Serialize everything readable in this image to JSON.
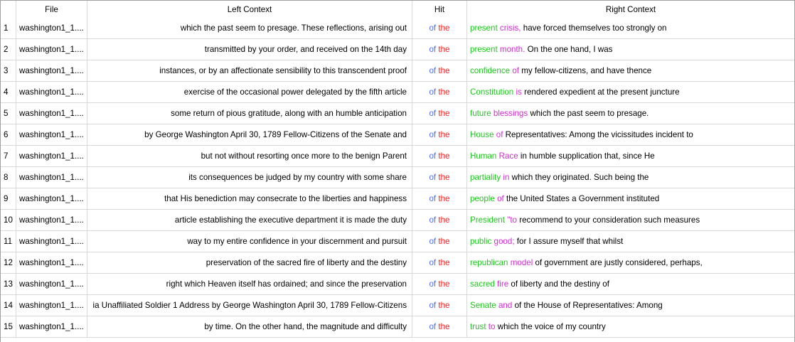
{
  "columns": {
    "num": "",
    "file": "File",
    "left": "Left Context",
    "hit": "Hit",
    "right": "Right Context"
  },
  "colors": {
    "hit_word1": "#4a6cf7",
    "hit_word2": "#ff1a1a",
    "right_word1": "#1ec81e",
    "right_word2": "#d22bd2"
  },
  "rows": [
    {
      "n": "1",
      "file": "washington1_1....",
      "left": "which the past seem to presage. These reflections, arising out",
      "hit1": "of",
      "hit2": "the",
      "r1": "present",
      "r2": "crisis,",
      "rest": "have forced themselves too strongly on"
    },
    {
      "n": "2",
      "file": "washington1_1....",
      "left": "transmitted by your order, and received on the 14th day",
      "hit1": "of",
      "hit2": "the",
      "r1": "present",
      "r2": "month.",
      "rest": "On the one hand, I was"
    },
    {
      "n": "3",
      "file": "washington1_1....",
      "left": "instances, or by an affectionate sensibility to this transcendent proof",
      "hit1": "of",
      "hit2": "the",
      "r1": "confidence",
      "r2": "of",
      "rest": "my fellow-citizens, and have thence"
    },
    {
      "n": "4",
      "file": "washington1_1....",
      "left": "exercise of the occasional power delegated by the fifth article",
      "hit1": "of",
      "hit2": "the",
      "r1": "Constitution",
      "r2": "is",
      "rest": "rendered expedient at the present juncture"
    },
    {
      "n": "5",
      "file": "washington1_1....",
      "left": "some return of pious gratitude, along with an humble anticipation",
      "hit1": "of",
      "hit2": "the",
      "r1": "future",
      "r2": "blessings",
      "rest": "which the past seem to presage."
    },
    {
      "n": "6",
      "file": "washington1_1....",
      "left": "by George Washington April 30, 1789 Fellow-Citizens of the Senate and",
      "hit1": "of",
      "hit2": "the",
      "r1": "House",
      "r2": "of",
      "rest": "Representatives: Among the vicissitudes incident to"
    },
    {
      "n": "7",
      "file": "washington1_1....",
      "left": "but not without resorting once more to the benign Parent",
      "hit1": "of",
      "hit2": "the",
      "r1": "Human",
      "r2": "Race",
      "rest": "in humble supplication that, since He"
    },
    {
      "n": "8",
      "file": "washington1_1....",
      "left": "its consequences be judged by my country with some share",
      "hit1": "of",
      "hit2": "the",
      "r1": "partiality",
      "r2": "in",
      "rest": "which they originated. Such being the"
    },
    {
      "n": "9",
      "file": "washington1_1....",
      "left": "that His benediction may consecrate to the liberties and happiness",
      "hit1": "of",
      "hit2": "the",
      "r1": "people",
      "r2": "of",
      "rest": "the United States a Government instituted"
    },
    {
      "n": "10",
      "file": "washington1_1....",
      "left": "article establishing the executive department it is made the duty",
      "hit1": "of",
      "hit2": "the",
      "r1": "President",
      "r2": "\"to",
      "rest": "recommend to your consideration such measures"
    },
    {
      "n": "11",
      "file": "washington1_1....",
      "left": "way to my entire confidence in your discernment and pursuit",
      "hit1": "of",
      "hit2": "the",
      "r1": "public",
      "r2": "good;",
      "rest": "for I assure myself that whilst"
    },
    {
      "n": "12",
      "file": "washington1_1....",
      "left": "preservation of the sacred fire of liberty and the destiny",
      "hit1": "of",
      "hit2": "the",
      "r1": "republican",
      "r2": "model",
      "rest": "of government are justly considered, perhaps,"
    },
    {
      "n": "13",
      "file": "washington1_1....",
      "left": "right which Heaven itself has ordained; and since the preservation",
      "hit1": "of",
      "hit2": "the",
      "r1": "sacred",
      "r2": "fire",
      "rest": "of liberty and the destiny of"
    },
    {
      "n": "14",
      "file": "washington1_1....",
      "left": "ia Unaffiliated Soldier 1 Address by George Washington April 30, 1789 Fellow-Citizens",
      "hit1": "of",
      "hit2": "the",
      "r1": "Senate",
      "r2": "and",
      "rest": "of the House of Representatives: Among"
    },
    {
      "n": "15",
      "file": "washington1_1....",
      "left": "by time. On the other hand, the magnitude and difficulty",
      "hit1": "of",
      "hit2": "the",
      "r1": "trust",
      "r2": "to",
      "rest": "which the voice of my country"
    }
  ]
}
